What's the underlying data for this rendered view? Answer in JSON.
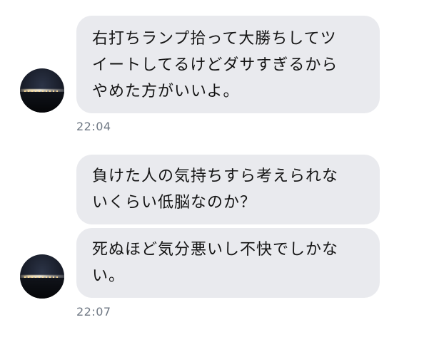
{
  "messages": [
    {
      "lines": [
        "右打ちランプ拾って大勝ちしてツ",
        "イートしてるけどダサすぎるから",
        "やめた方がいいよ。"
      ]
    },
    {
      "lines": [
        "負けた人の気持ちすら考えられな",
        "いくらい低脳なのか？"
      ]
    },
    {
      "lines": [
        "死ぬほど気分悪いし不快でしかな",
        "い。"
      ]
    }
  ],
  "timestamps": [
    "22:04",
    "22:07"
  ],
  "colors": {
    "bubble_bg": "#e9eaee",
    "text": "#141414",
    "timestamp": "#6e7783"
  }
}
